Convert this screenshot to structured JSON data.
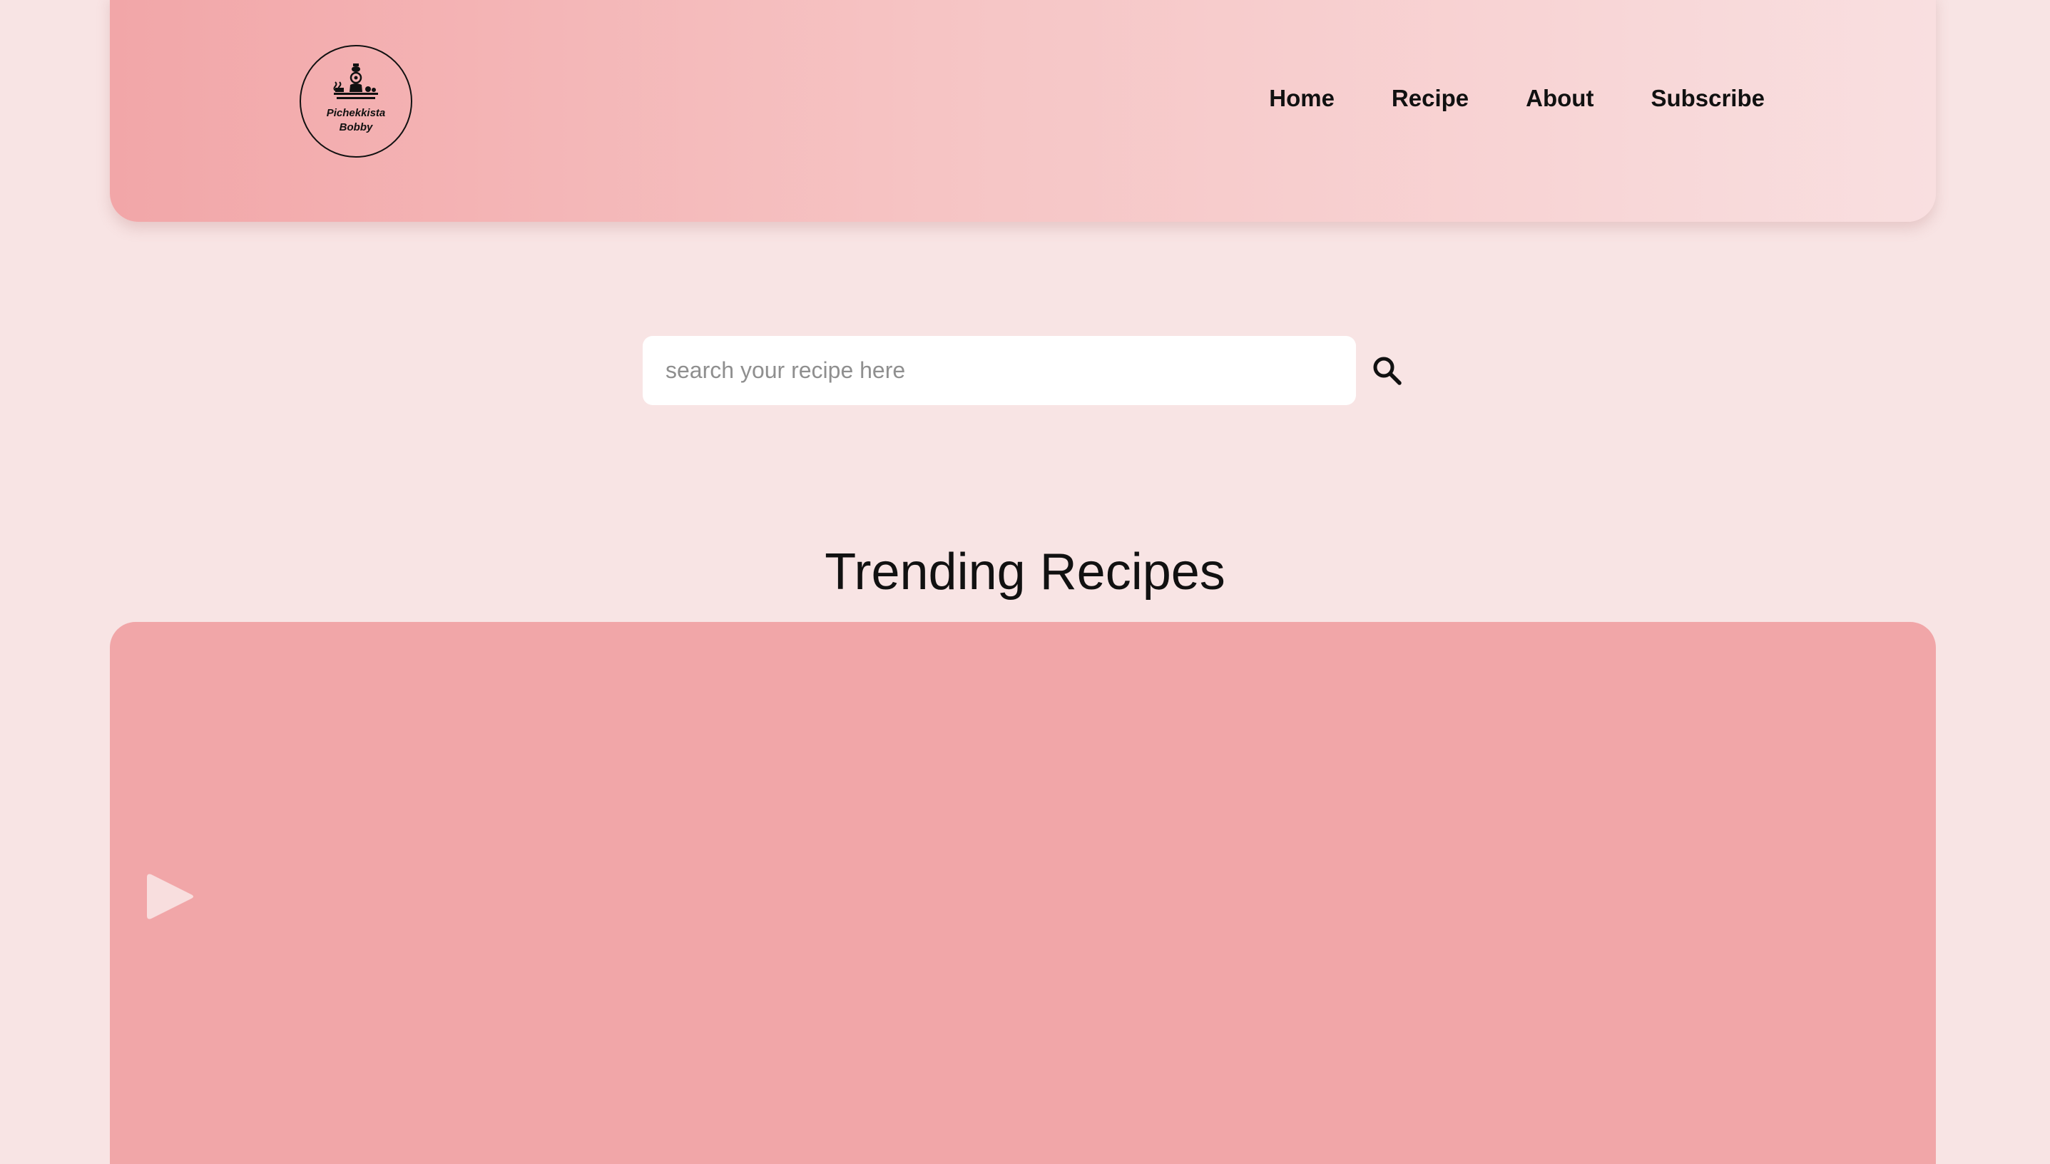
{
  "header": {
    "logo": {
      "line1": "Pichekkista",
      "line2": "Bobby",
      "icon": "chef-cooking-icon"
    },
    "nav": [
      {
        "label": "Home"
      },
      {
        "label": "Recipe"
      },
      {
        "label": "About"
      },
      {
        "label": "Subscribe"
      }
    ]
  },
  "search": {
    "placeholder": "search your recipe here",
    "value": "",
    "icon": "search-icon"
  },
  "trending": {
    "title": "Trending Recipes",
    "arrow_icon": "play-arrow-icon"
  },
  "colors": {
    "background": "#f8e4e4",
    "header_gradient_start": "#f2a6a8",
    "header_gradient_end": "#f9dfe0",
    "carousel_bg": "#f1a6a8",
    "text": "#111111"
  }
}
